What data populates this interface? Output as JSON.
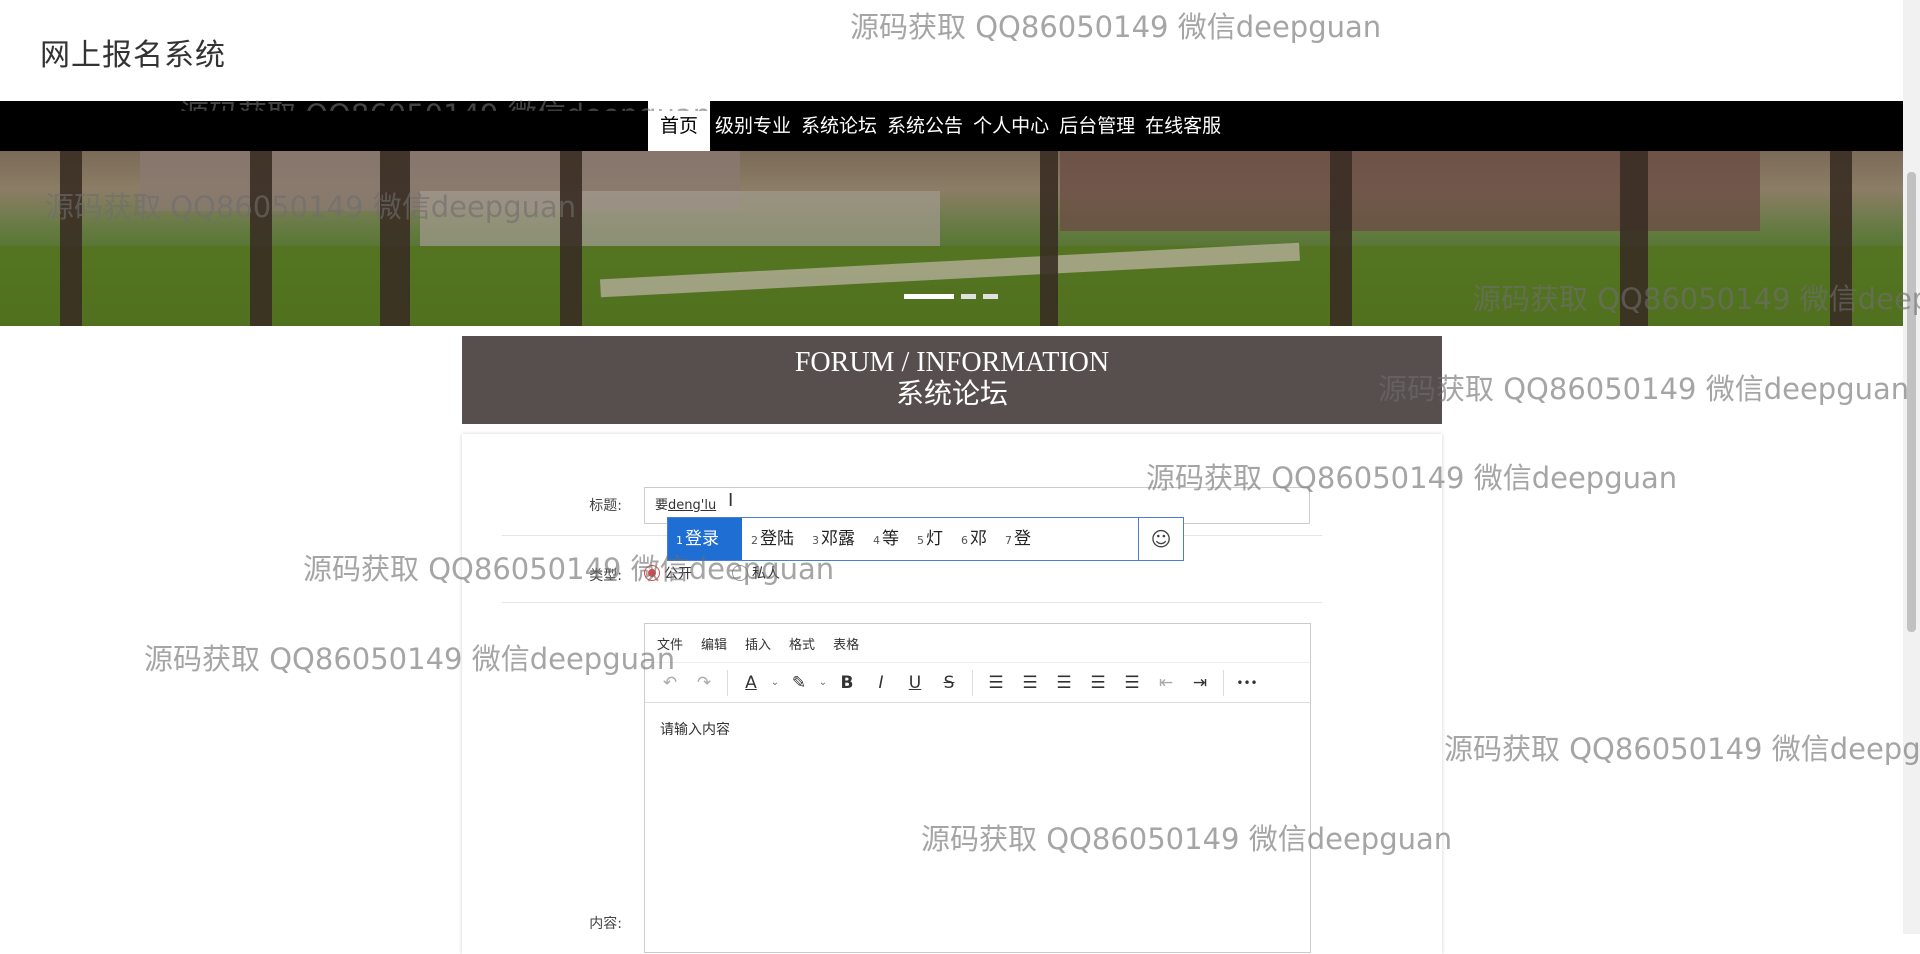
{
  "app": {
    "title": "网上报名系统"
  },
  "nav": {
    "items": [
      "首页",
      "级别专业",
      "系统论坛",
      "系统公告",
      "个人中心",
      "后台管理",
      "在线客服"
    ],
    "active_index": 0
  },
  "banner": {
    "slide_count": 3,
    "active_slide": 1
  },
  "section": {
    "title_en": "FORUM / INFORMATION",
    "title_cn": "系统论坛"
  },
  "form": {
    "title_label": "标题:",
    "title_value_committed": "要",
    "title_value_composing": "deng'lu",
    "type_label": "类型:",
    "type_options": [
      "公开",
      "私人"
    ],
    "type_selected": "公开",
    "content_label": "内容:"
  },
  "editor": {
    "menus": [
      "文件",
      "编辑",
      "插入",
      "格式",
      "表格"
    ],
    "placeholder": "请输入内容",
    "toolbar": {
      "undo": "↶",
      "redo": "↷",
      "text_color": "A",
      "highlight": "✎",
      "bold": "B",
      "italic": "I",
      "underline": "U",
      "strike": "S",
      "line_height": "☰",
      "align_left": "☰",
      "align_center": "☰",
      "align_right": "☰",
      "justify": "☰",
      "outdent": "⇤",
      "indent": "⇥",
      "more": "•••",
      "caret": "⌄"
    }
  },
  "ime": {
    "candidates": [
      {
        "num": "1",
        "text": "登录"
      },
      {
        "num": "2",
        "text": "登陆"
      },
      {
        "num": "3",
        "text": "邓露"
      },
      {
        "num": "4",
        "text": "等"
      },
      {
        "num": "5",
        "text": "灯"
      },
      {
        "num": "6",
        "text": "邓"
      },
      {
        "num": "7",
        "text": "登"
      }
    ],
    "selected_index": 0,
    "emoji": "☺"
  },
  "cursor": "I",
  "watermark": "源码获取 QQ86050149 微信deepguan"
}
